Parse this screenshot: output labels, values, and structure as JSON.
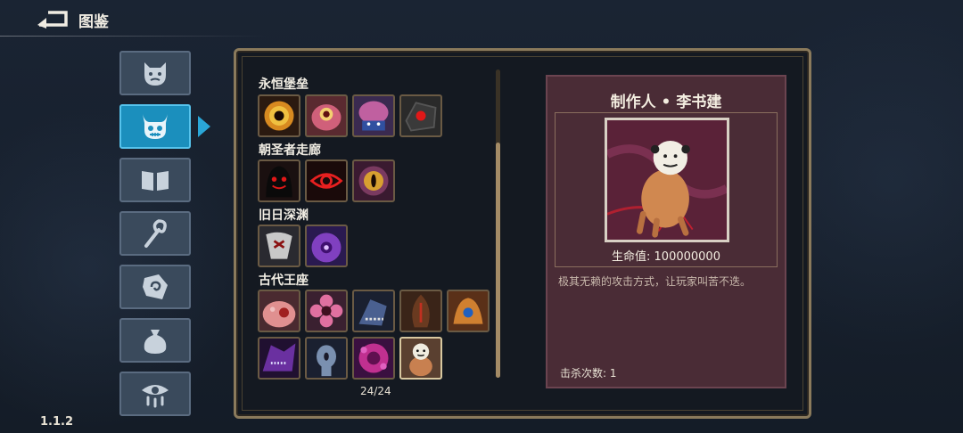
{
  "header": {
    "title": "图鉴"
  },
  "version": "1.1.2",
  "tabs": [
    {
      "icon": "demon-face-icon"
    },
    {
      "icon": "horned-skull-icon",
      "active": true
    },
    {
      "icon": "open-book-icon"
    },
    {
      "icon": "staff-icon"
    },
    {
      "icon": "rune-stone-icon"
    },
    {
      "icon": "pouch-icon"
    },
    {
      "icon": "crying-eye-icon"
    }
  ],
  "groups": [
    {
      "title": "永恒堡垒",
      "monsters": [
        "yellow-eye-orb",
        "pink-cyclops",
        "brain-creature",
        "red-eye-rock"
      ]
    },
    {
      "title": "朝圣者走廊",
      "monsters": [
        "shadow-hooded",
        "red-eye-sigil",
        "golden-eye"
      ]
    },
    {
      "title": "旧日深渊",
      "monsters": [
        "bone-wraith",
        "purple-blob"
      ]
    },
    {
      "title": "古代王座",
      "monsters": [
        "flesh-mound",
        "pink-flower",
        "blue-serpent",
        "dark-cocoon",
        "fire-beast",
        "purple-dragon",
        "pale-ghoul",
        "magenta-spores",
        "meme-dog"
      ]
    }
  ],
  "collection_count": "24/24",
  "detail": {
    "name": "制作人 • 李书建",
    "hp_label": "生命值: 100000000",
    "description": "极其无赖的攻击方式，让玩家叫苦不迭。",
    "kills_label": "击杀次数: 1"
  },
  "colors": {
    "accent": "#1b8fbd",
    "panel_border": "#8a7a5c",
    "detail_bg": "#4a2c36"
  }
}
